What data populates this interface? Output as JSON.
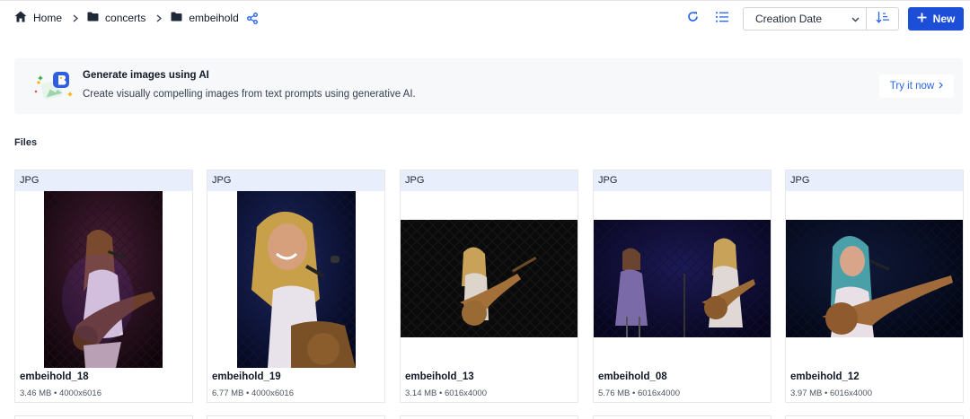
{
  "breadcrumb": [
    {
      "label": "Home",
      "icon": "home-icon"
    },
    {
      "label": "concerts",
      "icon": "folder-icon"
    },
    {
      "label": "embeihold",
      "icon": "folder-icon"
    }
  ],
  "toolbar": {
    "sort_field": "Creation Date",
    "new_label": "New",
    "accent": "#1d4ed8"
  },
  "banner": {
    "title": "Generate images using AI",
    "description": "Create visually compelling images from text prompts using generative AI.",
    "cta_label": "Try it now",
    "cta_color": "#2563eb"
  },
  "files_section": {
    "title": "Files"
  },
  "files": [
    {
      "type": "JPG",
      "name": "embeihold_18",
      "meta": "3.46 MB • 4000x6016",
      "orientation": "portrait"
    },
    {
      "type": "JPG",
      "name": "embeihold_19",
      "meta": "6.77 MB • 4000x6016",
      "orientation": "portrait"
    },
    {
      "type": "JPG",
      "name": "embeihold_13",
      "meta": "3.14 MB • 6016x4000",
      "orientation": "landscape"
    },
    {
      "type": "JPG",
      "name": "embeihold_08",
      "meta": "5.76 MB • 6016x4000",
      "orientation": "landscape"
    },
    {
      "type": "JPG",
      "name": "embeihold_12",
      "meta": "3.97 MB • 6016x4000",
      "orientation": "landscape"
    }
  ]
}
